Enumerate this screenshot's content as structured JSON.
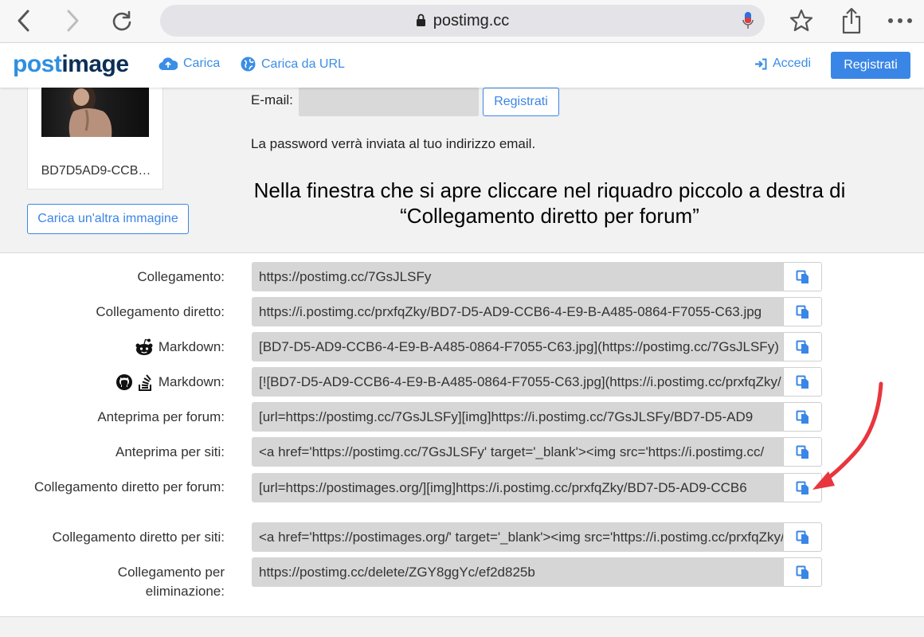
{
  "browser": {
    "url": "postimg.cc",
    "back_icon": "chevron-left-icon",
    "forward_icon": "chevron-right-icon",
    "reload_icon": "reload-icon",
    "mic_icon": "microphone-icon",
    "bookmark_icon": "star-icon",
    "share_icon": "share-icon",
    "more_icon": "more-icon"
  },
  "header": {
    "logo_post": "post",
    "logo_image": "image",
    "upload_label": "Carica",
    "upload_url_label": "Carica da URL",
    "login_label": "Accedi",
    "register_label": "Registrati"
  },
  "upload": {
    "filename": "BD7D5AD9-CCB…",
    "upload_another_label": "Carica un'altra immagine",
    "email_label": "E-mail:",
    "email_value": "",
    "register_button_label": "Registrati",
    "password_note": "La password verrà inviata al tuo indirizzo email."
  },
  "instruction_text": "Nella finestra che si apre cliccare nel riquadro piccolo a destra di “Collegamento diretto per forum”",
  "links": [
    {
      "label": "Collegamento:",
      "value": "https://postimg.cc/7GsJLSFy"
    },
    {
      "label": "Collegamento diretto:",
      "value": "https://i.postimg.cc/prxfqZky/BD7-D5-AD9-CCB6-4-E9-B-A485-0864-F7055-C63.jpg"
    },
    {
      "label": "Markdown:",
      "value": "[BD7-D5-AD9-CCB6-4-E9-B-A485-0864-F7055-C63.jpg](https://postimg.cc/7GsJLSFy)",
      "icon": "reddit-icon"
    },
    {
      "label": "Markdown:",
      "value": "[![BD7-D5-AD9-CCB6-4-E9-B-A485-0864-F7055-C63.jpg](https://i.postimg.cc/prxfqZky/",
      "icon": "github-icon",
      "icon2": "stackoverflow-icon"
    },
    {
      "label": "Anteprima per forum:",
      "value": "[url=https://postimg.cc/7GsJLSFy][img]https://i.postimg.cc/7GsJLSFy/BD7-D5-AD9"
    },
    {
      "label": "Anteprima per siti:",
      "value": "<a href='https://postimg.cc/7GsJLSFy' target='_blank'><img src='https://i.postimg.cc/"
    },
    {
      "label": "Collegamento diretto per forum:",
      "value": "[url=https://postimages.org/][img]https://i.postimg.cc/prxfqZky/BD7-D5-AD9-CCB6"
    },
    {
      "label": "Collegamento diretto per siti:",
      "value": "<a href='https://postimages.org/' target='_blank'><img src='https://i.postimg.cc/prxfqZky/"
    },
    {
      "label": "Collegamento per eliminazione:",
      "value": "https://postimg.cc/delete/ZGY8ggYc/ef2d825b"
    }
  ],
  "copy_icon": "copy-icon",
  "colors": {
    "accent": "#3a86e6",
    "arrow": "#e8363f",
    "logo_light": "#2f8fe0",
    "logo_dark": "#0c2f57"
  }
}
